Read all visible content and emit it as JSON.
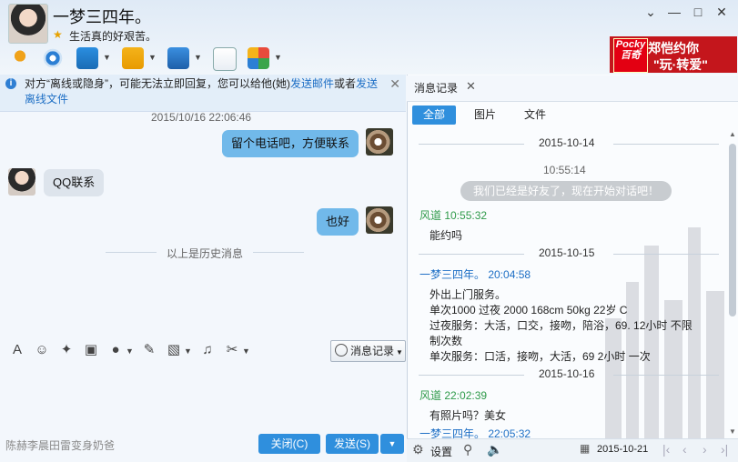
{
  "header": {
    "contact_name": "一梦三四年。",
    "signature": "生活真的好艰苦。",
    "window_buttons": [
      "chevron-down-icon",
      "minimize-icon",
      "maximize-icon",
      "close-icon"
    ]
  },
  "ad": {
    "brand": "Pocky 百奇",
    "line1": "郑恺约你",
    "line2": "\"玩·转爱\""
  },
  "notice": {
    "text_before": "对方“离线或隐身”，可能无法立即回复，您可以给他(她)",
    "link1": "发送邮件",
    "middle": "或者",
    "link2": "发送离线文件"
  },
  "chat": {
    "timestamp": "2015/10/16 22:06:46",
    "messages": [
      {
        "from": "me",
        "text": "留个电话吧，方便联系"
      },
      {
        "from": "peer",
        "text": "QQ联系"
      },
      {
        "from": "me",
        "text": "也好"
      }
    ],
    "history_divider": "以上是历史消息"
  },
  "input": {
    "history_button": "消息记录",
    "placeholder": "陈赫李晨田雷变身奶爸",
    "close_button": "关闭(C)",
    "send_button": "发送(S)"
  },
  "history_panel": {
    "tab_label": "消息记录",
    "filters": [
      "全部",
      "图片",
      "文件"
    ],
    "entries": {
      "d1": "2015-10-14",
      "t1": "10:55:14",
      "system": "我们已经是好友了，现在开始对话吧！",
      "m1_name": "风道 10:55:32",
      "m1_text": "能约吗",
      "d2": "2015-10-15",
      "m2_name": "一梦三四年。 20:04:58",
      "m2_l1": "外出上门服务。",
      "m2_l2": "单次1000   过夜 2000 168cm  50kg  22岁 C",
      "m2_l3": "过夜服务：大活，口交，接吻，陪浴，69. 12小时 不限",
      "m2_l4": "制次数",
      "m2_l5": "单次服务：口活，接吻，大活，69     2小时    一次",
      "d3": "2015-10-16",
      "m3_name": "风道 22:02:39",
      "m3_text": "有照片吗？美女",
      "m4_name": "一梦三四年。 22:05:32"
    },
    "settings_label": "设置",
    "date_value": "2015-10-21"
  }
}
